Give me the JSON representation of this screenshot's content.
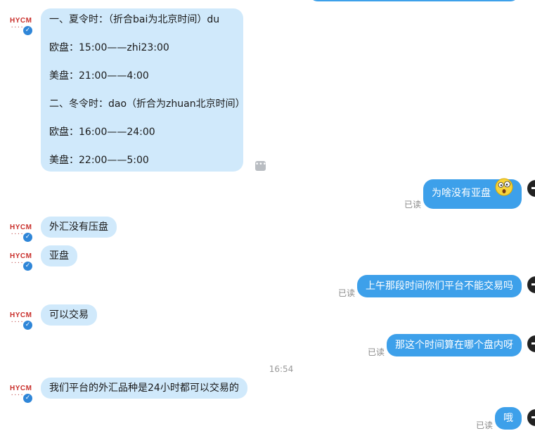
{
  "messages": {
    "m1": {
      "lines": [
        "一、夏令时：（折合bai为北京时间）du",
        "欧盘：15:00——zhi23:00",
        "美盘：21:00——4:00",
        "二、冬令时：dao（折合为zhuan北京时间）",
        "欧盘：16:00——24:00",
        "美盘：22:00——5:00"
      ]
    },
    "m2": {
      "text": "为啥没有亚盘",
      "status": "已读"
    },
    "m3": {
      "text": "外汇没有压盘"
    },
    "m4": {
      "text": "亚盘"
    },
    "m5": {
      "text": "上午那段时间你们平台不能交易吗",
      "status": "已读"
    },
    "m6": {
      "text": "可以交易"
    },
    "m7": {
      "text": "那这个时间算在哪个盘内呀",
      "status": "已读"
    },
    "time_separator": "16:54",
    "m8": {
      "text": "我们平台的外汇品种是24小时都可以交易的"
    },
    "m9": {
      "text": "哦",
      "status": "已读"
    }
  },
  "contact": {
    "logo": "HYCM"
  },
  "icons": {
    "more": "more-dots-icon",
    "verified": "verified-badge-icon",
    "emoji": "surprised-emoji-icon"
  },
  "colors": {
    "incoming": "#d0e9fb",
    "outgoing": "#3da0ea"
  }
}
